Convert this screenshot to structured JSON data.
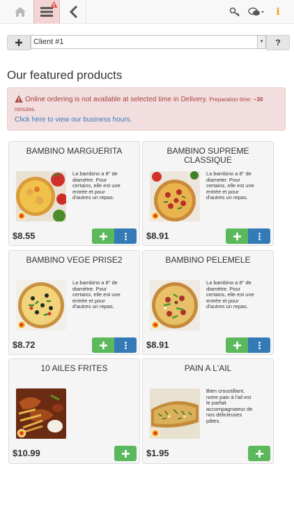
{
  "topbar": {
    "home_icon": "home-icon",
    "menu_icon": "hamburger-menu-icon",
    "back_icon": "chevron-left-icon",
    "key_icon": "key-icon",
    "chat_icon": "chat-bubbles-icon",
    "info_icon": "info-icon",
    "info_glyph": "i"
  },
  "client": {
    "add_glyph": "+",
    "selected": "Client #1",
    "help_label": "?"
  },
  "section_title": "Our featured products",
  "alert": {
    "message": "Online ordering is not available at selected time in Delivery.",
    "prep_label": "Preparation time:",
    "prep_value": "~30",
    "prep_unit": "minutes.",
    "hours_link": "Click here to view our business hours.",
    "color": "#a94442"
  },
  "products": [
    {
      "name": "BAMBINO MARGUERITA",
      "description": "La bambino a 8\" de diamètre. Pour certains, elle est une entrée et pour d'autres un repas.",
      "price": "$8.55",
      "has_more": true
    },
    {
      "name": "BAMBINO SUPREME CLASSIQUE",
      "description": "La bambino a 8\" de diameter. Pour certains, elle est une entrée et pour d'autres un repas.",
      "price": "$8.91",
      "has_more": true
    },
    {
      "name": "BAMBINO VEGE PRISE2",
      "description": "La bambino a 8\" de diamètre. Pour certains, elle est une entrée et pour d'autres un repas.",
      "price": "$8.72",
      "has_more": true
    },
    {
      "name": "BAMBINO PELEMELE",
      "description": "La bambino a 8\" de diamètre. Pour certains, elle est une entrée et pour d'autres un repas.",
      "price": "$8.91",
      "has_more": true
    },
    {
      "name": "10 AILES FRITES",
      "description": "",
      "price": "$10.99",
      "has_more": false
    },
    {
      "name": "PAIN A L'AIL",
      "description": "Bien croustillant, notre pain à l'ail est le parfait accompagnateur de nos délicieuses pâtes.",
      "price": "$1.95",
      "has_more": false
    }
  ],
  "colors": {
    "add": "#5cb85c",
    "more": "#337ab7",
    "accent": "#f0a020"
  }
}
